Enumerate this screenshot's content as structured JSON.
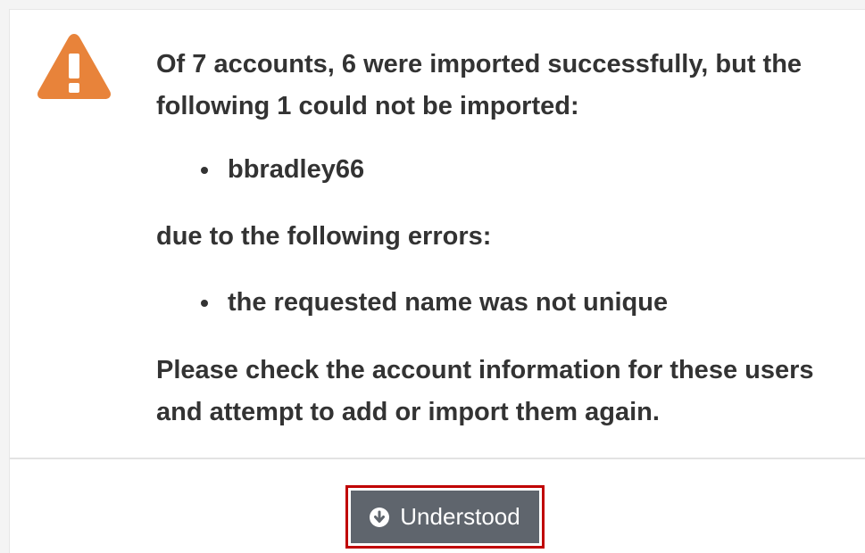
{
  "dialog": {
    "icon": "warning-triangle-icon",
    "icon_color": "#e8833a",
    "summary": "Of 7 accounts, 6 were imported successfully, but the following 1 could not be imported:",
    "failed_accounts": [
      "bbradley66"
    ],
    "errors_intro": "due to the following errors:",
    "errors": [
      "the requested name was not unique"
    ],
    "instruction": "Please check the account information for these users and attempt to add or import them again."
  },
  "footer": {
    "button_label": "Understood",
    "button_icon": "circle-arrow-down-icon",
    "button_color": "#5f656d",
    "highlight_color": "#c00000"
  }
}
